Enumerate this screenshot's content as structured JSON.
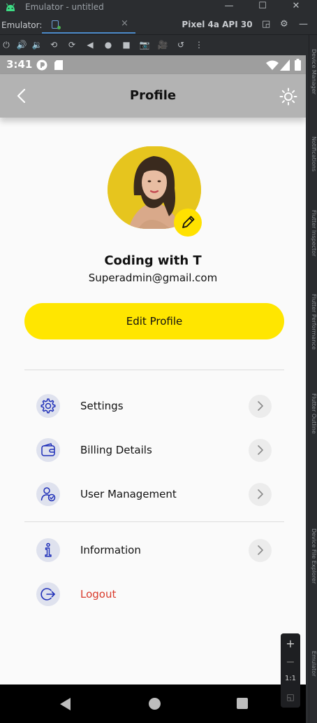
{
  "window": {
    "title": "Emulator - untitled"
  },
  "tabbar": {
    "label": "Emulator:",
    "device_tab": "Pixel 4a API 30"
  },
  "sidepanel": {
    "labels": [
      "Device Manager",
      "Notifications",
      "Flutter Inspector",
      "Flutter Performance",
      "Flutter Outline",
      "Device File Explorer",
      "Emulator"
    ]
  },
  "status": {
    "time": "3:41"
  },
  "appbar": {
    "title": "Profile"
  },
  "profile": {
    "name": "Coding with T",
    "email": "Superadmin@gmail.com",
    "edit_button": "Edit Profile"
  },
  "menu": {
    "items": [
      {
        "label": "Settings",
        "icon": "gear-icon"
      },
      {
        "label": "Billing Details",
        "icon": "wallet-icon"
      },
      {
        "label": "User Management",
        "icon": "user-check-icon"
      },
      {
        "label": "Information",
        "icon": "info-icon"
      },
      {
        "label": "Logout",
        "icon": "logout-icon"
      }
    ]
  },
  "zoom": {
    "plus": "+",
    "minus": "−",
    "ratio": "1:1"
  },
  "colors": {
    "accent": "#FFE600",
    "icon_blue": "#1f2fb8",
    "logout_red": "#D93A2B",
    "appbar": "#B3B3B3"
  }
}
